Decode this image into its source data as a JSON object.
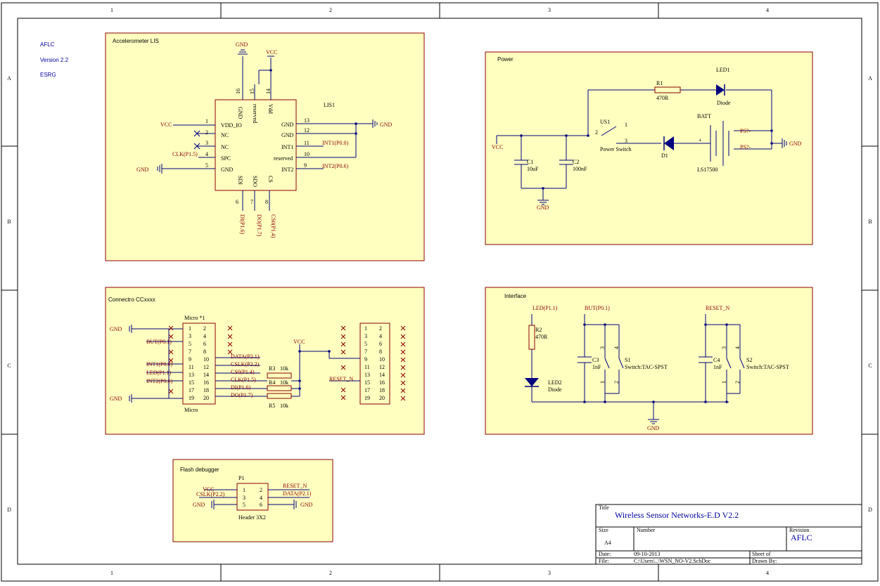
{
  "border": {
    "cols": [
      "1",
      "2",
      "3",
      "4"
    ],
    "rows": [
      "A",
      "B",
      "C",
      "D"
    ]
  },
  "header_notes": {
    "org": "AFLC",
    "version": "Version 2.2",
    "group": "ESRG"
  },
  "accel": {
    "title": "Accelerometer LIS",
    "ref": "LIS1",
    "gnd_top": "GND",
    "vcc_top": "VCC",
    "vcc_left": "VCC",
    "gnd_left": "GND",
    "gnd_right": "GND",
    "clk_net": "CLK(P1.5)",
    "int1_net": "INT1(P0.0)",
    "int2_net": "INT2(P0.6)",
    "di_net": "DI(P1.6)",
    "do_net": "DO(P1.7)",
    "cs_net": "CS0(P1.4)",
    "pins_left": [
      {
        "num": "1",
        "name": "VDD_IO"
      },
      {
        "num": "2",
        "name": "NC"
      },
      {
        "num": "3",
        "name": "NC"
      },
      {
        "num": "4",
        "name": "SPC"
      },
      {
        "num": "5",
        "name": "GND"
      }
    ],
    "pins_right": [
      {
        "num": "13",
        "name": "GND"
      },
      {
        "num": "12",
        "name": "GND"
      },
      {
        "num": "11",
        "name": "INT1"
      },
      {
        "num": "10",
        "name": "reserved"
      },
      {
        "num": "9",
        "name": "INT2"
      }
    ],
    "pins_top": [
      {
        "num": "16",
        "name": "GND"
      },
      {
        "num": "15",
        "name": "reserved"
      },
      {
        "num": "14",
        "name": "Vdd"
      }
    ],
    "pins_bottom": [
      {
        "num": "6",
        "name": "SDI"
      },
      {
        "num": "7",
        "name": "SDO"
      },
      {
        "num": "8",
        "name": "CS"
      }
    ]
  },
  "power": {
    "title": "Power",
    "r1": "R1",
    "r1_val": "470R",
    "led1": "LED1",
    "led1_type": "Diode",
    "us1": "US1",
    "us1_type": "Power Switch",
    "batt": "BATT",
    "batt_type": "LS17500",
    "d1": "D1",
    "c1": "C1",
    "c1_val": "10uF",
    "c2": "C2",
    "c2_val": "100nF",
    "vcc": "VCC",
    "gnd_bottom": "GND",
    "gnd_right": "GND",
    "ps_top": "PS?-",
    "ps_bot": "PS?-",
    "plus": "+",
    "sw_p1": "1",
    "sw_p2": "2",
    "sw_p3": "3"
  },
  "connector": {
    "title": "Connectro CCxxxx",
    "ref": "Micro *1",
    "type": "Micro",
    "gnd_top": "GND",
    "gnd_bottom": "GND",
    "vcc": "VCC",
    "reset_net": "RESET_N",
    "left_nets": [
      "BUT(P0.1)",
      "INT1(P0.0)",
      "LED(P1.1)",
      "INT2(P0.6)"
    ],
    "right_nets": [
      "DATA(P2.1)",
      "CSLK(P2.2)",
      "CS0(P1.4)",
      "CLK(P1.5)",
      "DI(P1.6)",
      "DO(P1.7)"
    ],
    "r3": "R3",
    "r3_val": "10k",
    "r4": "R4",
    "r4_val": "10k",
    "r5": "R5",
    "r5_val": "10k",
    "left_pins_odd": [
      "1",
      "3",
      "5",
      "7",
      "9",
      "11",
      "13",
      "15",
      "17",
      "19"
    ],
    "left_pins_even": [
      "2",
      "4",
      "6",
      "8",
      "10",
      "12",
      "14",
      "16",
      "18",
      "20"
    ],
    "right_pins_odd": [
      "1",
      "3",
      "5",
      "7",
      "9",
      "11",
      "13",
      "15",
      "17",
      "19"
    ],
    "right_pins_even": [
      "2",
      "4",
      "6",
      "8",
      "10",
      "12",
      "14",
      "16",
      "18",
      "20"
    ]
  },
  "interface": {
    "title": "Interface",
    "led_net": "LED(P1.1)",
    "but_net": "BUT(P0.1)",
    "reset_net": "RESET_N",
    "r2": "R2",
    "r2_val": "470R",
    "led2": "LED2",
    "led2_type": "Diode",
    "c3": "C3",
    "c3_val": "1nF",
    "c4": "C4",
    "c4_val": "1nF",
    "s1": "S1",
    "s1_type": "Switch:TAC-SPST",
    "s2": "S2",
    "s2_type": "Switch:TAC-SPST",
    "gnd": "GND",
    "sw_pins": [
      "3",
      "4",
      "1",
      "2"
    ]
  },
  "debugger": {
    "title": "Flash debugger",
    "ref": "P1",
    "type": "Header 3X2",
    "vcc": "VCC",
    "cslk": "CSLK(P2.2)",
    "gnd_left": "GND",
    "reset": "RESET_N",
    "data": "DATA(P2.1)",
    "gnd_right": "GND",
    "pins_left": [
      "1",
      "3",
      "5"
    ],
    "pins_right": [
      "2",
      "4",
      "6"
    ]
  },
  "title_block": {
    "title_label": "Title",
    "title": "Wireless Sensor Networks-E.D V2.2",
    "size_label": "Size",
    "size": "A4",
    "number_label": "Number",
    "revision_label": "Revision",
    "revision": "AFLC",
    "date_label": "Date:",
    "date": "09-10-2013",
    "sheet_label": "Sheet    of",
    "file_label": "File:",
    "file": "C:\\Users\\..\\WSN_NO-V2.SchDoc",
    "drawn_label": "Drawn By:"
  },
  "colors": {
    "panel_fill": "#ffffc0",
    "panel_border": "#8b0000",
    "wire": "#000080",
    "net_text": "#8b0000",
    "text": "#000000",
    "blue_text": "#0000a0"
  }
}
